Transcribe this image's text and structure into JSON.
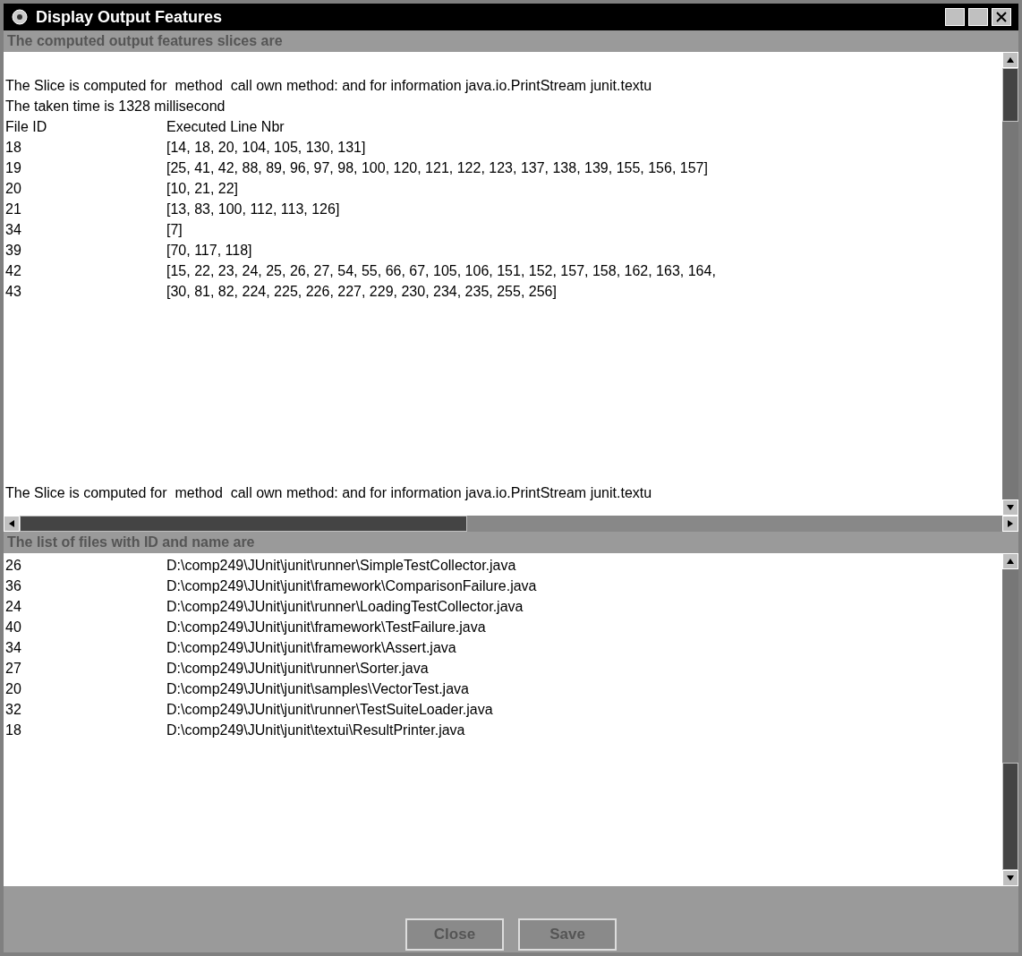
{
  "window": {
    "title": "Display Output Features"
  },
  "output_label": "The computed output features slices are",
  "slices": [
    {
      "intro": "The Slice is computed for  method  call own method: and for information java.io.PrintStream junit.textu",
      "time": "The taken time is 1328 millisecond",
      "columns": [
        "File ID",
        "Executed Line Nbr"
      ],
      "rows": [
        {
          "file_id": "18",
          "lines": "[14, 18, 20, 104, 105, 130, 131]"
        },
        {
          "file_id": "19",
          "lines": "[25, 41, 42, 88, 89, 96, 97, 98, 100, 120, 121, 122, 123, 137, 138, 139, 155, 156, 157]"
        },
        {
          "file_id": "20",
          "lines": "[10, 21, 22]"
        },
        {
          "file_id": "21",
          "lines": "[13, 83, 100, 112, 113, 126]"
        },
        {
          "file_id": "34",
          "lines": "[7]"
        },
        {
          "file_id": "39",
          "lines": "[70, 117, 118]"
        },
        {
          "file_id": "42",
          "lines": "[15, 22, 23, 24, 25, 26, 27, 54, 55, 66, 67, 105, 106, 151, 152, 157, 158, 162, 163, 164,"
        },
        {
          "file_id": "43",
          "lines": "[30, 81, 82, 224, 225, 226, 227, 229, 230, 234, 235, 255, 256]"
        }
      ]
    },
    {
      "intro": "The Slice is computed for  method  call own method: and for information java.io.PrintStream junit.textu"
    }
  ],
  "files_label": "The list of files with ID and name are",
  "files": [
    {
      "id": "26",
      "path": "D:\\comp249\\JUnit\\junit\\runner\\SimpleTestCollector.java"
    },
    {
      "id": "36",
      "path": "D:\\comp249\\JUnit\\junit\\framework\\ComparisonFailure.java"
    },
    {
      "id": "24",
      "path": "D:\\comp249\\JUnit\\junit\\runner\\LoadingTestCollector.java"
    },
    {
      "id": "40",
      "path": "D:\\comp249\\JUnit\\junit\\framework\\TestFailure.java"
    },
    {
      "id": "34",
      "path": "D:\\comp249\\JUnit\\junit\\framework\\Assert.java"
    },
    {
      "id": "27",
      "path": "D:\\comp249\\JUnit\\junit\\runner\\Sorter.java"
    },
    {
      "id": "20",
      "path": "D:\\comp249\\JUnit\\junit\\samples\\VectorTest.java"
    },
    {
      "id": "32",
      "path": "D:\\comp249\\JUnit\\junit\\runner\\TestSuiteLoader.java"
    },
    {
      "id": "18",
      "path": "D:\\comp249\\JUnit\\junit\\textui\\ResultPrinter.java"
    }
  ],
  "buttons": [
    "Close",
    "Save"
  ]
}
